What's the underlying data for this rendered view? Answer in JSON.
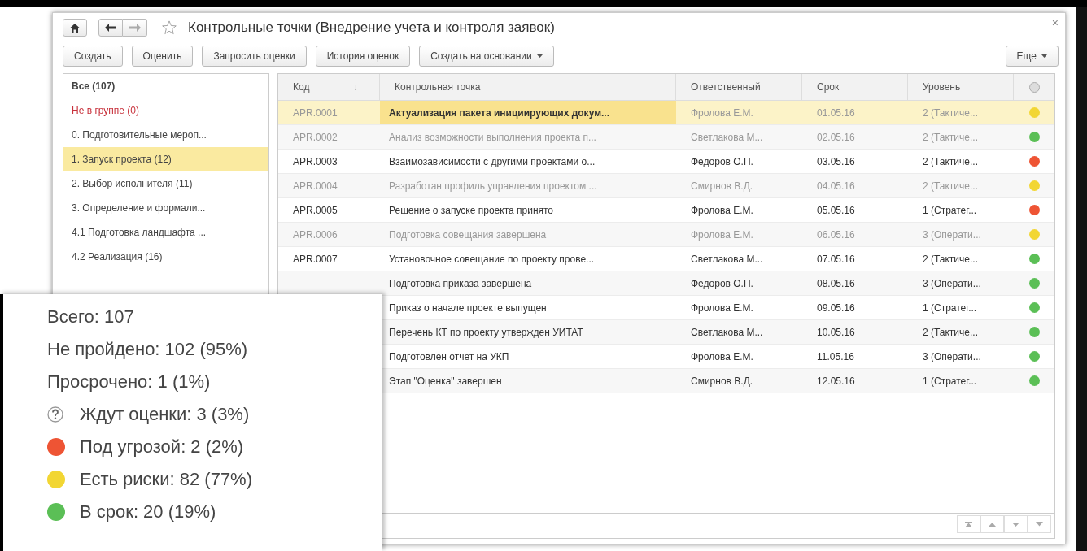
{
  "window": {
    "title": "Контрольные точки (Внедрение учета и контроля заявок)",
    "favorite": false,
    "close": "×"
  },
  "toolbar": {
    "buttons": [
      {
        "label": "Создать",
        "dropdown": false
      },
      {
        "label": "Оценить",
        "dropdown": false
      },
      {
        "label": "Запросить оценки",
        "dropdown": false
      },
      {
        "label": "История оценок",
        "dropdown": false
      },
      {
        "label": "Создать на основании",
        "dropdown": true
      }
    ],
    "more": {
      "label": "Еще",
      "dropdown": true
    }
  },
  "sidebar": {
    "items": [
      {
        "label": "Все (107)",
        "kind": "total",
        "selected": false
      },
      {
        "label": "Не в группе (0)",
        "kind": "ungrouped",
        "selected": false
      },
      {
        "label": "0. Подготовительные мероп...",
        "kind": "group",
        "selected": false
      },
      {
        "label": "1. Запуск проекта (12)",
        "kind": "group",
        "selected": true
      },
      {
        "label": "2. Выбор исполнителя (11)",
        "kind": "group",
        "selected": false
      },
      {
        "label": "3. Определение и формали...",
        "kind": "group",
        "selected": false
      },
      {
        "label": "4.1 Подготовка ландшафта ...",
        "kind": "group",
        "selected": false
      },
      {
        "label": "4.2 Реализация (16)",
        "kind": "group",
        "selected": false
      }
    ]
  },
  "table": {
    "columns": [
      {
        "label": "Код",
        "sort_mark": "↓"
      },
      {
        "label": "Контрольная точка"
      },
      {
        "label": "Ответственный"
      },
      {
        "label": "Срок"
      },
      {
        "label": "Уровень"
      },
      {
        "kind": "status"
      }
    ],
    "rows": [
      {
        "code": "APR.0001",
        "name": "Актуализация пакета инициирующих докум...",
        "owner": "Фролова Е.М.",
        "due": "01.05.16",
        "level_text": "2 (Тактиче...",
        "color": "#f2d633",
        "dimmed": true,
        "selected": true
      },
      {
        "code": "APR.0002",
        "name": "Анализ возможности выполнения проекта п...",
        "owner": "Светлакова М...",
        "due": "02.05.16",
        "level_text": "2 (Тактиче...",
        "color": "#5bbf56",
        "dimmed": true,
        "selected": false
      },
      {
        "code": "APR.0003",
        "name": "Взаимозависимости с другими проектами о...",
        "owner": "Федоров О.П.",
        "due": "03.05.16",
        "level_text": "2 (Тактиче...",
        "color": "#ee5434",
        "dimmed": false,
        "selected": false
      },
      {
        "code": "APR.0004",
        "name": "Разработан профиль управления проектом ...",
        "owner": "Смирнов В.Д.",
        "due": "04.05.16",
        "level_text": "2 (Тактиче...",
        "color": "#f2d633",
        "dimmed": true,
        "selected": false
      },
      {
        "code": "APR.0005",
        "name": "Решение о запуске проекта принято",
        "owner": "Фролова Е.М.",
        "due": "05.05.16",
        "level_text": "1 (Стратег...",
        "color": "#ee5434",
        "dimmed": false,
        "selected": false
      },
      {
        "code": "APR.0006",
        "name": "Подготовка совещания завершена",
        "owner": "Фролова Е.М.",
        "due": "06.05.16",
        "level_text": "3 (Операти...",
        "color": "#f2d633",
        "dimmed": true,
        "selected": false
      },
      {
        "code": "APR.0007",
        "name": "Установочное совещание  по проекту прове...",
        "owner": "Светлакова М...",
        "due": "07.05.16",
        "level_text": "2 (Тактиче...",
        "color": "#5bbf56",
        "dimmed": false,
        "selected": false
      },
      {
        "name": "Подготовка приказа завершена",
        "owner": "Федоров О.П.",
        "due": "08.05.16",
        "level_text": "3 (Операти...",
        "color": "#5bbf56",
        "dimmed": false,
        "selected": false
      },
      {
        "name": "Приказ о начале проекте выпущен",
        "owner": "Фролова Е.М.",
        "due": "09.05.16",
        "level_text": "1 (Стратег...",
        "color": "#5bbf56",
        "dimmed": false,
        "selected": false
      },
      {
        "name": "Перечень КТ по проекту утвержден УИТАТ",
        "owner": "Светлакова М...",
        "due": "10.05.16",
        "level_text": "2 (Тактиче...",
        "color": "#5bbf56",
        "dimmed": false,
        "selected": false
      },
      {
        "name": "Подготовлен отчет на УКП",
        "owner": "Фролова Е.М.",
        "due": "11.05.16",
        "level_text": "3 (Операти...",
        "color": "#5bbf56",
        "dimmed": false,
        "selected": false
      },
      {
        "name": "Этап \"Оценка\" завершен",
        "owner": "Смирнов В.Д.",
        "due": "12.05.16",
        "level_text": "1 (Стратег...",
        "color": "#5bbf56",
        "dimmed": false,
        "selected": false
      }
    ]
  },
  "legend": {
    "items": [
      {
        "kind": "plain",
        "text": "Всего: 107"
      },
      {
        "kind": "plain",
        "text": "Не пройдено: 102 (95%)"
      },
      {
        "kind": "plain",
        "text": "Просрочено: 1 (1%)"
      },
      {
        "kind": "question",
        "text": "Ждут оценки: 3 (3%)"
      },
      {
        "kind": "dot",
        "text": "Под угрозой: 2 (2%)",
        "color": "#ee5434"
      },
      {
        "kind": "dot",
        "text": "Есть риски: 82 (77%)",
        "color": "#f2d633"
      },
      {
        "kind": "dot",
        "text": "В срок: 20 (19%)",
        "color": "#5bbf56"
      }
    ]
  }
}
